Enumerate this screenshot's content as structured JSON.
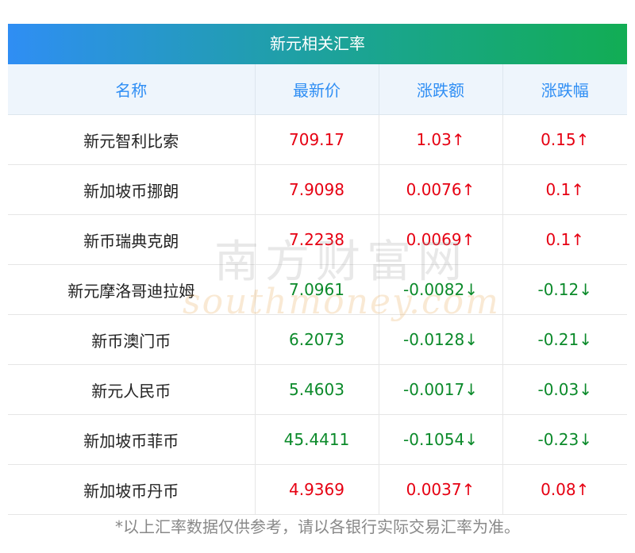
{
  "title": "新元相关汇率",
  "headers": {
    "name": "名称",
    "price": "最新价",
    "change": "涨跌额",
    "pct": "涨跌幅"
  },
  "rows": [
    {
      "name": "新元智利比索",
      "price": "709.17",
      "change": "1.03↑",
      "pct": "0.15↑",
      "dir": "up"
    },
    {
      "name": "新加坡币挪朗",
      "price": "7.9098",
      "change": "0.0076↑",
      "pct": "0.1↑",
      "dir": "up"
    },
    {
      "name": "新币瑞典克朗",
      "price": "7.2238",
      "change": "0.0069↑",
      "pct": "0.1↑",
      "dir": "up"
    },
    {
      "name": "新元摩洛哥迪拉姆",
      "price": "7.0961",
      "change": "-0.0082↓",
      "pct": "-0.12↓",
      "dir": "down"
    },
    {
      "name": "新币澳门币",
      "price": "6.2073",
      "change": "-0.0128↓",
      "pct": "-0.21↓",
      "dir": "down"
    },
    {
      "name": "新元人民币",
      "price": "5.4603",
      "change": "-0.0017↓",
      "pct": "-0.03↓",
      "dir": "down"
    },
    {
      "name": "新加坡币菲币",
      "price": "45.4411",
      "change": "-0.1054↓",
      "pct": "-0.23↓",
      "dir": "down"
    },
    {
      "name": "新加坡币丹币",
      "price": "4.9369",
      "change": "0.0037↑",
      "pct": "0.08↑",
      "dir": "up"
    }
  ],
  "watermark": {
    "cn": "南方财富网",
    "en": "southmoney.com"
  },
  "footnote": "*以上汇率数据仅供参考，请以各银行实际交易汇率为准。",
  "colors": {
    "up": "#e60012",
    "down": "#0b8a2a",
    "header_text": "#2f8ef4",
    "title_start": "#2f8ef4",
    "title_end": "#12ad54"
  }
}
